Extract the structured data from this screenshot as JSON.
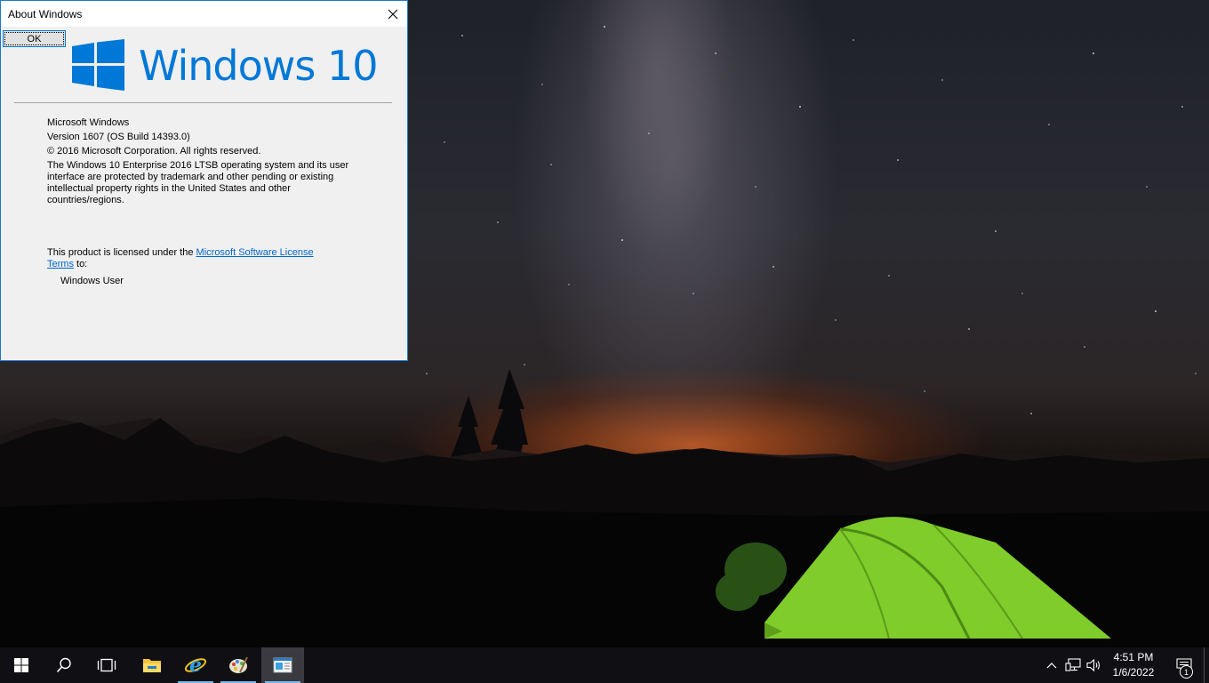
{
  "dialog": {
    "title": "About Windows",
    "ok_label": "OK",
    "logo_text": "Windows 10",
    "product_name": "Microsoft Windows",
    "version": "Version 1607 (OS Build 14393.0)",
    "copyright": "© 2016 Microsoft Corporation. All rights reserved.",
    "legal_line1": "The Windows 10 Enterprise 2016 LTSB operating system and its user",
    "legal_line2": "interface are protected by trademark and other pending or existing",
    "legal_line3": "intellectual property rights in the United States and other",
    "legal_line4": "countries/regions.",
    "license_prefix": "This product is licensed under the ",
    "license_link_part1": "Microsoft Software License",
    "license_link_part2": "Terms",
    "license_suffix": " to:",
    "licensed_user": "Windows User",
    "accent_color": "#0078d7"
  },
  "taskbar": {
    "clock_time": "4:51 PM",
    "clock_date": "1/6/2022",
    "notification_count": "1",
    "pinned": [
      {
        "name": "start-button",
        "icon": "windows-logo-icon"
      },
      {
        "name": "search-button",
        "icon": "search-icon"
      },
      {
        "name": "task-view-button",
        "icon": "task-view-icon"
      },
      {
        "name": "file-explorer",
        "icon": "folder-icon"
      },
      {
        "name": "internet-explorer",
        "icon": "ie-icon"
      },
      {
        "name": "paint",
        "icon": "paint-icon"
      },
      {
        "name": "about-windows-task",
        "icon": "window-icon"
      }
    ]
  }
}
